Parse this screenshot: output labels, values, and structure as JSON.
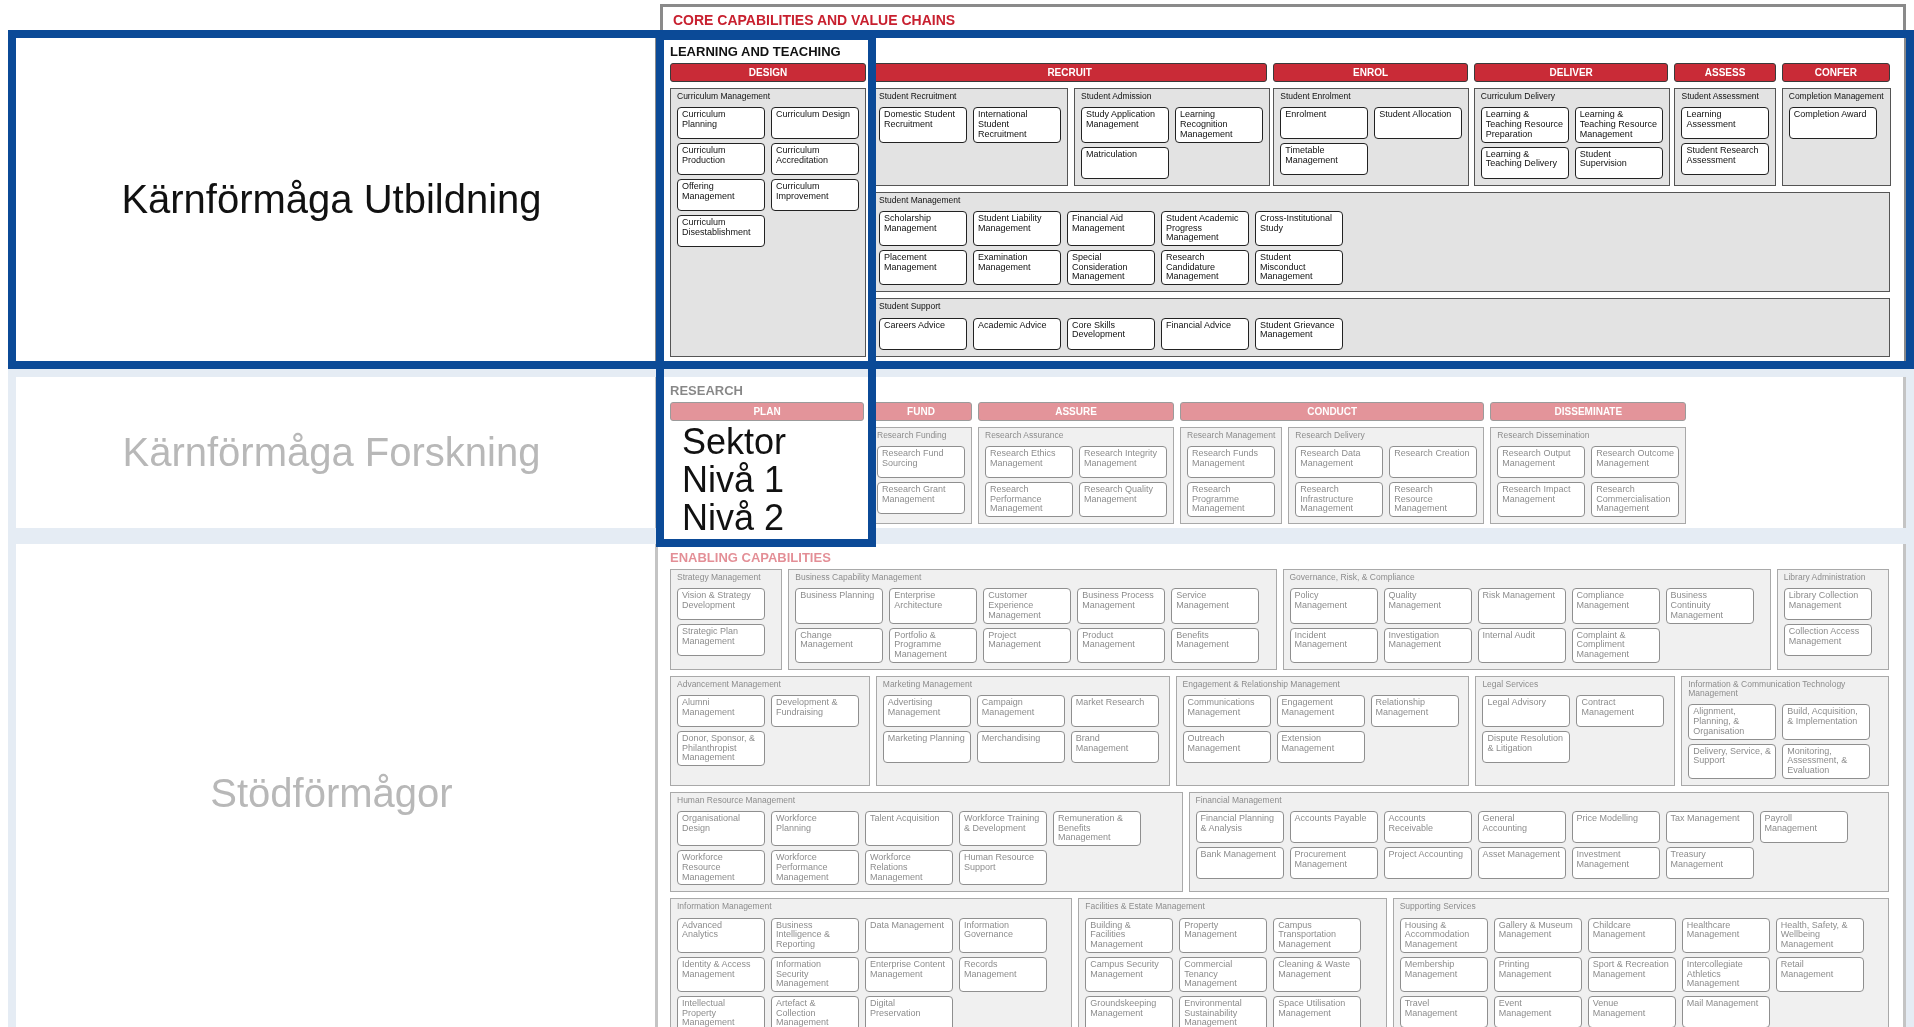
{
  "map_title": "CORE CAPABILITIES AND VALUE CHAINS",
  "legend": [
    "Sektor",
    "Nivå 1",
    "Nivå 2"
  ],
  "rows": [
    {
      "label": "Kärnförmåga Utbildning",
      "highlighted": true,
      "section": {
        "kind": "value_chain",
        "title": "LEARNING AND TEACHING",
        "stages": [
          {
            "label": "DESIGN",
            "highlighted": true,
            "groups": [
              {
                "title": "Curriculum Management",
                "items": [
                  "Curriculum Planning",
                  "Curriculum Design",
                  "Curriculum Production",
                  "Curriculum Accreditation",
                  "Offering Management",
                  "Curriculum Improvement",
                  "Curriculum Disestablishment"
                ]
              }
            ]
          },
          {
            "label": "RECRUIT",
            "highlighted": false,
            "groups": [
              {
                "title": "Student Recruitment",
                "items": [
                  "Domestic Student Recruitment",
                  "International Student Recruitment"
                ]
              },
              {
                "title": "Student Admission",
                "items": [
                  "Study Application Management",
                  "Learning Recognition Management",
                  "Matriculation"
                ]
              }
            ]
          },
          {
            "label": "ENROL",
            "highlighted": false,
            "groups": [
              {
                "title": "Student Enrolment",
                "items": [
                  "Enrolment",
                  "Student Allocation",
                  "Timetable Management"
                ]
              }
            ]
          },
          {
            "label": "DELIVER",
            "highlighted": false,
            "groups": [
              {
                "title": "Curriculum Delivery",
                "items": [
                  "Learning & Teaching Resource Preparation",
                  "Learning & Teaching Resource Management",
                  "Learning & Teaching Delivery",
                  "Student Supervision"
                ]
              }
            ]
          },
          {
            "label": "ASSESS",
            "highlighted": false,
            "groups": [
              {
                "title": "Student Assessment",
                "items": [
                  "Learning Assessment",
                  "Student Research Assessment"
                ]
              }
            ]
          },
          {
            "label": "CONFER",
            "highlighted": false,
            "groups": [
              {
                "title": "Completion Management",
                "items": [
                  "Completion Award"
                ]
              }
            ]
          }
        ],
        "wide_groups": [
          {
            "title": "Student Management",
            "items": [
              "Scholarship Management",
              "Student Liability Management",
              "Financial Aid Management",
              "Student Academic Progress Management",
              "Cross-Institutional Study",
              "Placement Management",
              "Examination Management",
              "Special Consideration Management",
              "Research Candidature Management",
              "Student Misconduct Management"
            ]
          },
          {
            "title": "Student Support",
            "items": [
              "Careers Advice",
              "Academic Advice",
              "Core Skills Development",
              "Financial Advice",
              "Student Grievance Management"
            ]
          }
        ]
      }
    },
    {
      "label": "Kärnförmåga Forskning",
      "highlighted": false,
      "section": {
        "kind": "value_chain",
        "title": "RESEARCH",
        "stages": [
          {
            "label": "PLAN",
            "highlighted": false
          },
          {
            "label": "FUND",
            "highlighted": false,
            "groups": [
              {
                "title": "Research Funding",
                "items": [
                  "Research Fund Sourcing",
                  "Research Grant Management"
                ]
              }
            ]
          },
          {
            "label": "ASSURE",
            "highlighted": false,
            "groups": [
              {
                "title": "Research Assurance",
                "items": [
                  "Research Ethics Management",
                  "Research Integrity Management",
                  "Research Performance Management",
                  "Research Quality Management"
                ]
              }
            ]
          },
          {
            "label": "CONDUCT",
            "highlighted": false,
            "groups": [
              {
                "title": "Research Management",
                "items": [
                  "Research Funds Management",
                  "Research Programme Management"
                ]
              },
              {
                "title": "Research Delivery",
                "items": [
                  "Research Data Management",
                  "Research Creation",
                  "Research Infrastructure Management",
                  "Research Resource Management"
                ]
              }
            ]
          },
          {
            "label": "DISSEMINATE",
            "highlighted": false,
            "groups": [
              {
                "title": "Research Dissemination",
                "items": [
                  "Research Output Management",
                  "Research Outcome Management",
                  "Research Impact Management",
                  "Research Commercialisation Management"
                ]
              }
            ]
          }
        ]
      }
    },
    {
      "label": "Stödförmågor",
      "highlighted": false,
      "section": {
        "kind": "grid",
        "title": "ENABLING CAPABILITIES",
        "group_rows": [
          [
            {
              "title": "Strategy Management",
              "items": [
                "Vision & Strategy Development",
                "Strategic Plan Management"
              ]
            },
            {
              "title": "Business Capability Management",
              "items": [
                "Business Planning",
                "Enterprise Architecture",
                "Customer Experience Management",
                "Business Process Management",
                "Service Management",
                "Change Management",
                "Portfolio & Programme Management",
                "Project Management",
                "Product Management",
                "Benefits Management"
              ]
            },
            {
              "title": "Governance, Risk, & Compliance",
              "items": [
                "Policy Management",
                "Quality Management",
                "Risk Management",
                "Compliance Management",
                "Business Continuity Management",
                "Incident Management",
                "Investigation Management",
                "Internal Audit",
                "Complaint & Compliment Management"
              ]
            },
            {
              "title": "Library Administration",
              "items": [
                "Library Collection Management",
                "Collection Access Management"
              ]
            }
          ],
          [
            {
              "title": "Advancement Management",
              "items": [
                "Alumni Management",
                "Development & Fundraising",
                "Donor, Sponsor, & Philanthropist Management"
              ]
            },
            {
              "title": "Marketing Management",
              "items": [
                "Advertising Management",
                "Campaign Management",
                "Market Research",
                "Marketing Planning",
                "Merchandising",
                "Brand Management"
              ]
            },
            {
              "title": "Engagement & Relationship Management",
              "items": [
                "Communications Management",
                "Engagement Management",
                "Relationship Management",
                "Outreach Management",
                "Extension Management"
              ]
            },
            {
              "title": "Legal Services",
              "items": [
                "Legal Advisory",
                "Contract Management",
                "Dispute Resolution & Litigation"
              ]
            },
            {
              "title": "Information & Communication Technology Management",
              "items": [
                "Alignment, Planning, & Organisation",
                "Build, Acquisition, & Implementation",
                "Delivery, Service, & Support",
                "Monitoring, Assessment, & Evaluation"
              ]
            }
          ],
          [
            {
              "title": "Human Resource Management",
              "items": [
                "Organisational Design",
                "Workforce Planning",
                "Talent Acquisition",
                "Workforce Training & Development",
                "Remuneration & Benefits Management",
                "Workforce Resource Management",
                "Workforce Performance Management",
                "Workforce Relations Management",
                "Human Resource Support"
              ]
            },
            {
              "title": "Financial Management",
              "items": [
                "Financial Planning & Analysis",
                "Accounts Payable",
                "Accounts Receivable",
                "General Accounting",
                "Price Modelling",
                "Tax Management",
                "Payroll Management",
                "Bank Management",
                "Procurement Management",
                "Project Accounting",
                "Asset Management",
                "Investment Management",
                "Treasury Management"
              ]
            }
          ],
          [
            {
              "title": "Information Management",
              "items": [
                "Advanced Analytics",
                "Business Intelligence & Reporting",
                "Data Management",
                "Information Governance",
                "Identity & Access Management",
                "Information Security Management",
                "Enterprise Content Management",
                "Records Management",
                "Intellectual Property Management",
                "Artefact & Collection Management",
                "Digital Preservation"
              ]
            },
            {
              "title": "Facilities & Estate Management",
              "items": [
                "Building & Facilities Management",
                "Property Management",
                "Campus Transportation Management",
                "Campus Security Management",
                "Commercial Tenancy Management",
                "Cleaning & Waste Management",
                "Groundskeeping Management",
                "Environmental Sustainability Management",
                "Space Utilisation Management"
              ]
            },
            {
              "title": "Supporting Services",
              "items": [
                "Housing & Accommodation Management",
                "Gallery & Museum Management",
                "Childcare Management",
                "Healthcare Management",
                "Health, Safety, & Wellbeing Management",
                "Membership Management",
                "Printing Management",
                "Sport & Recreation Management",
                "Intercollegiate Athletics Management",
                "Retail Management",
                "Travel Management",
                "Event Management",
                "Venue Management",
                "Mail Management"
              ]
            }
          ]
        ]
      }
    }
  ]
}
